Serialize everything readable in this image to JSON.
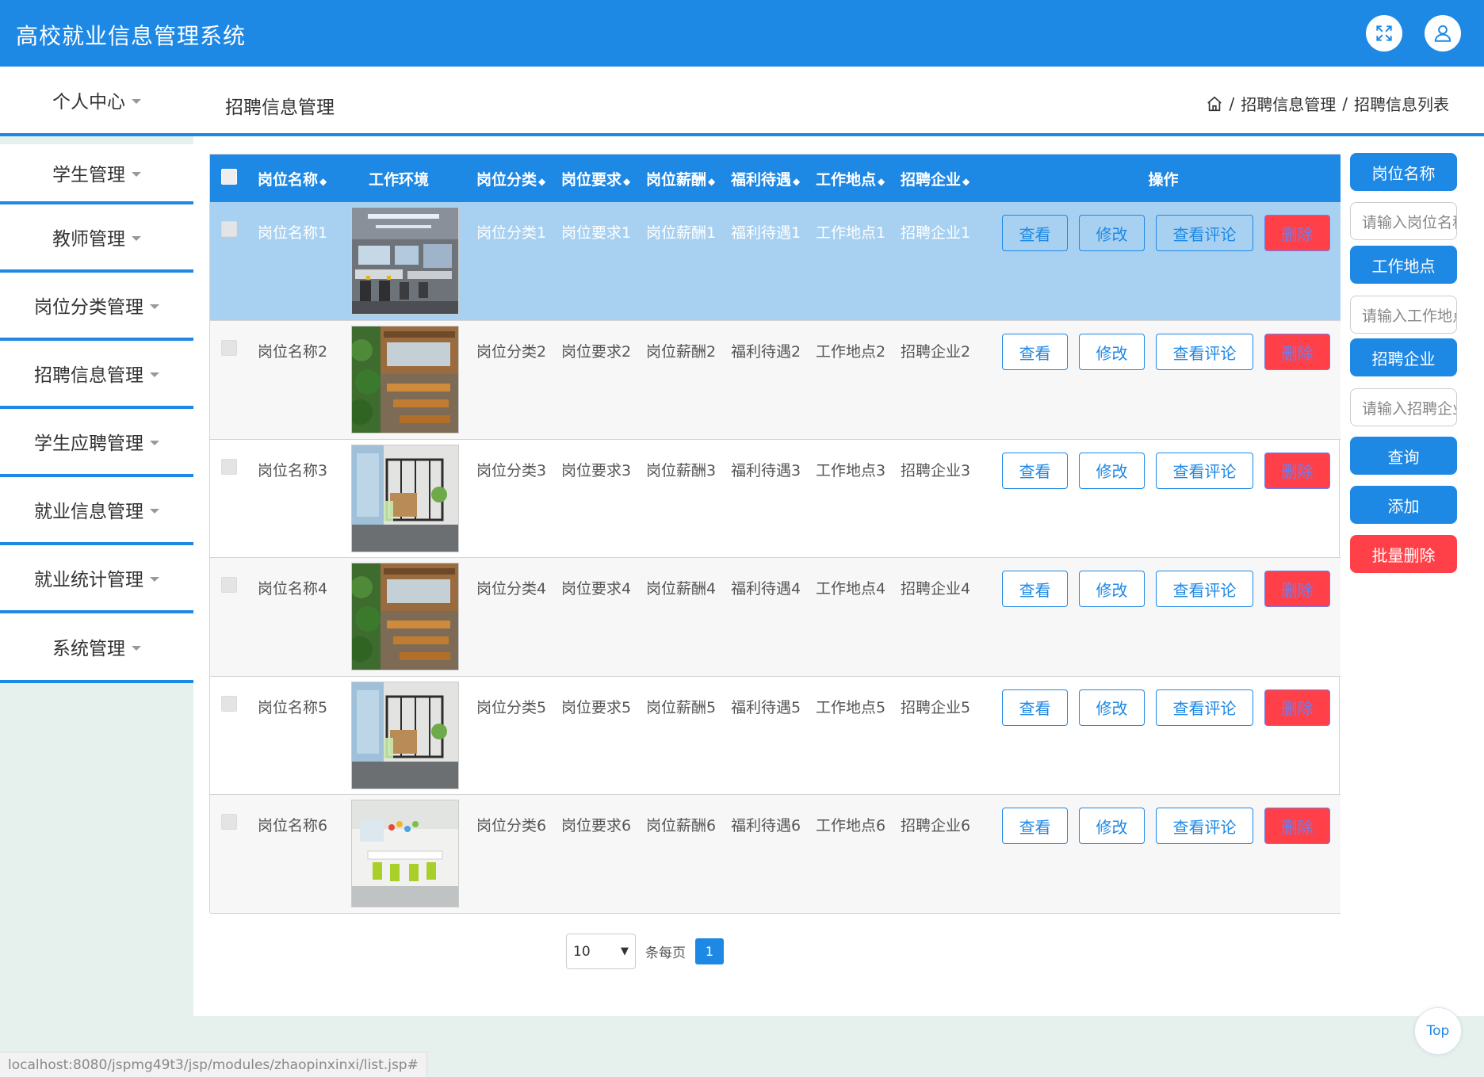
{
  "app": {
    "title": "高校就业信息管理系统"
  },
  "sidebar": {
    "items": [
      {
        "label": "个人中心"
      },
      {
        "label": "学生管理"
      },
      {
        "label": "教师管理"
      },
      {
        "label": "岗位分类管理"
      },
      {
        "label": "招聘信息管理"
      },
      {
        "label": "学生应聘管理"
      },
      {
        "label": "就业信息管理"
      },
      {
        "label": "就业统计管理"
      },
      {
        "label": "系统管理"
      }
    ]
  },
  "page": {
    "title": "招聘信息管理",
    "breadcrumb": [
      "招聘信息管理",
      "招聘信息列表"
    ],
    "breadcrumb_sep": "/"
  },
  "table": {
    "headers": [
      "岗位名称",
      "工作环境",
      "岗位分类",
      "岗位要求",
      "岗位薪酬",
      "福利待遇",
      "工作地点",
      "招聘企业",
      "操作"
    ],
    "sort_icon": "◆",
    "actions": {
      "view": "查看",
      "edit": "修改",
      "comments": "查看评论",
      "delete": "删除"
    },
    "rows": [
      {
        "name": "岗位名称1",
        "image": "office-cubicles",
        "category": "岗位分类1",
        "requirement": "岗位要求1",
        "salary": "岗位薪酬1",
        "benefits": "福利待遇1",
        "location": "工作地点1",
        "company": "招聘企业1",
        "selected": true
      },
      {
        "name": "岗位名称2",
        "image": "outdoor-cafe",
        "category": "岗位分类2",
        "requirement": "岗位要求2",
        "salary": "岗位薪酬2",
        "benefits": "福利待遇2",
        "location": "工作地点2",
        "company": "招聘企业2",
        "selected": false
      },
      {
        "name": "岗位名称3",
        "image": "glass-room",
        "category": "岗位分类3",
        "requirement": "岗位要求3",
        "salary": "岗位薪酬3",
        "benefits": "福利待遇3",
        "location": "工作地点3",
        "company": "招聘企业3",
        "selected": false
      },
      {
        "name": "岗位名称4",
        "image": "outdoor-cafe",
        "category": "岗位分类4",
        "requirement": "岗位要求4",
        "salary": "岗位薪酬4",
        "benefits": "福利待遇4",
        "location": "工作地点4",
        "company": "招聘企业4",
        "selected": false
      },
      {
        "name": "岗位名称5",
        "image": "glass-room",
        "category": "岗位分类5",
        "requirement": "岗位要求5",
        "salary": "岗位薪酬5",
        "benefits": "福利待遇5",
        "location": "工作地点5",
        "company": "招聘企业5",
        "selected": false
      },
      {
        "name": "岗位名称6",
        "image": "bright-office",
        "category": "岗位分类6",
        "requirement": "岗位要求6",
        "salary": "岗位薪酬6",
        "benefits": "福利待遇6",
        "location": "工作地点6",
        "company": "招聘企业6",
        "selected": false
      }
    ]
  },
  "pagination": {
    "page_size": "10",
    "per_page_label": "条每页",
    "current_page": "1"
  },
  "search": {
    "fields": [
      {
        "label": "岗位名称",
        "placeholder": "请输入岗位名称"
      },
      {
        "label": "工作地点",
        "placeholder": "请输入工作地点"
      },
      {
        "label": "招聘企业",
        "placeholder": "请输入招聘企业"
      }
    ],
    "query_button": "查询",
    "add_button": "添加",
    "batch_delete_button": "批量删除"
  },
  "top_button": "Top",
  "status_url": "localhost:8080/jspmg49t3/jsp/modules/zhaopinxinxi/list.jsp#",
  "colors": {
    "primary": "#1e88e5",
    "danger": "#ff4048",
    "selected_row": "#a8d1f1"
  }
}
